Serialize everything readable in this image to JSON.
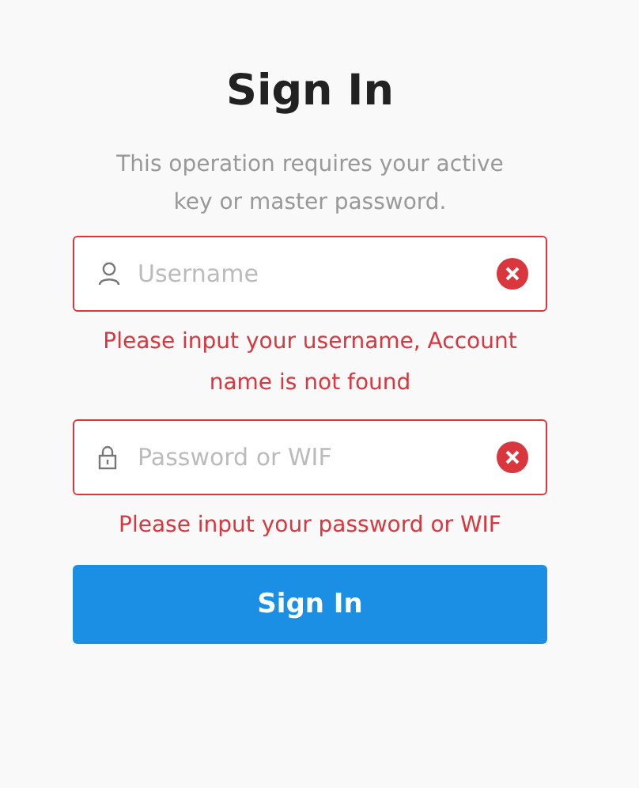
{
  "title": "Sign In",
  "subtitle": "This operation requires your active key or master password.",
  "fields": [
    {
      "kind": "user",
      "placeholder": "Username",
      "error": true,
      "message": "Please input your username, Account name is not found"
    },
    {
      "kind": "lock",
      "placeholder": "Password or WIF",
      "error": true,
      "message": "Please input your password or WIF"
    }
  ],
  "button": "Sign In"
}
